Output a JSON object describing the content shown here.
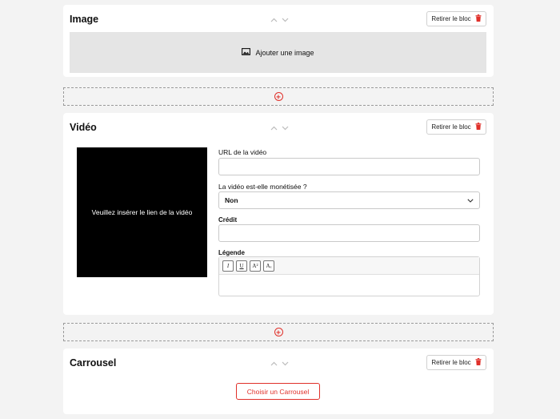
{
  "blocks": {
    "image": {
      "title": "Image",
      "remove_label": "Retirer le bloc",
      "add_image_label": "Ajouter une image"
    },
    "video": {
      "title": "Vidéo",
      "remove_label": "Retirer le bloc",
      "preview_text": "Veuillez insérer le lien de la vidéo",
      "url_label": "URL de la vidéo",
      "url_value": "",
      "monetized_label": "La vidéo est-elle monétisée ?",
      "monetized_value": "Non",
      "credit_label": "Crédit",
      "credit_value": "",
      "caption_label": "Légende",
      "caption_toolbar": [
        "I",
        "U",
        "A²",
        "Aₓ"
      ]
    },
    "carousel": {
      "title": "Carrousel",
      "remove_label": "Retirer le bloc",
      "choose_label": "Choisir un Carrousel"
    }
  },
  "colors": {
    "accent": "#e0302a",
    "background": "#f3f3f3",
    "card": "#ffffff"
  },
  "icons": {
    "move_up": "chevron-up-icon",
    "move_down": "chevron-down-icon",
    "remove": "trash-icon",
    "add_block": "plus-circle-icon",
    "add_image": "image-icon"
  }
}
